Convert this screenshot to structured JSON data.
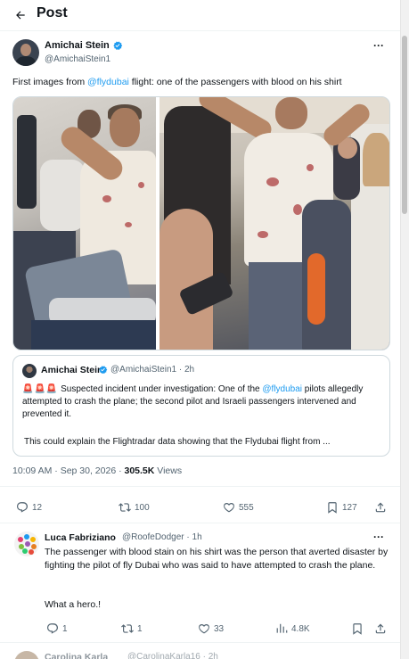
{
  "header": {
    "title": "Post",
    "back_icon": "arrow-left-icon"
  },
  "tweet": {
    "author_name": "Amichai Stein",
    "author_handle": "@AmichaiStein1",
    "text_before": "First images from ",
    "mention": "@flydubai",
    "text_after": " flight: one of the passengers with blood on his shirt",
    "timestamp": "10:09 AM · Sep 30, 2026 · ",
    "views_count": "305.5K",
    "views_label": " Views",
    "actions": {
      "replies": "12",
      "reposts": "100",
      "likes": "555",
      "bookmarks": "127"
    }
  },
  "quote": {
    "author_name": "Amichai Stein",
    "author_handle": "@AmichaiStein1 · 2h",
    "sirens": "🚨🚨🚨",
    "text_before": " Suspected incident under investigation: One of the ",
    "mention": "@flydubai",
    "text_after": " pilots allegedly attempted to crash the plane; the second pilot and Israeli passengers intervened and prevented it.",
    "text_second": "This could explain the Flightradar data showing that the Flydubai flight from ..."
  },
  "reply": {
    "author_name": "Luca Fabriziano",
    "author_handle": "@RoofeDodger · 1h",
    "text": "The passenger with blood stain on his shirt was the person that averted disaster by fighting the pilot of fly Dubai who was said to have attempted to crash the plane.",
    "text_second": "What a hero.!",
    "actions": {
      "replies": "1",
      "reposts": "1",
      "likes": "33",
      "views": "4.8K"
    }
  },
  "next_reply": {
    "author_name": "Carolina Karla",
    "author_handle": "@CarolinaKarla16 · 2h"
  },
  "colors": {
    "accent": "#1d9bf0",
    "text": "#0f1419",
    "muted": "#536471",
    "border": "#cfd9de"
  }
}
